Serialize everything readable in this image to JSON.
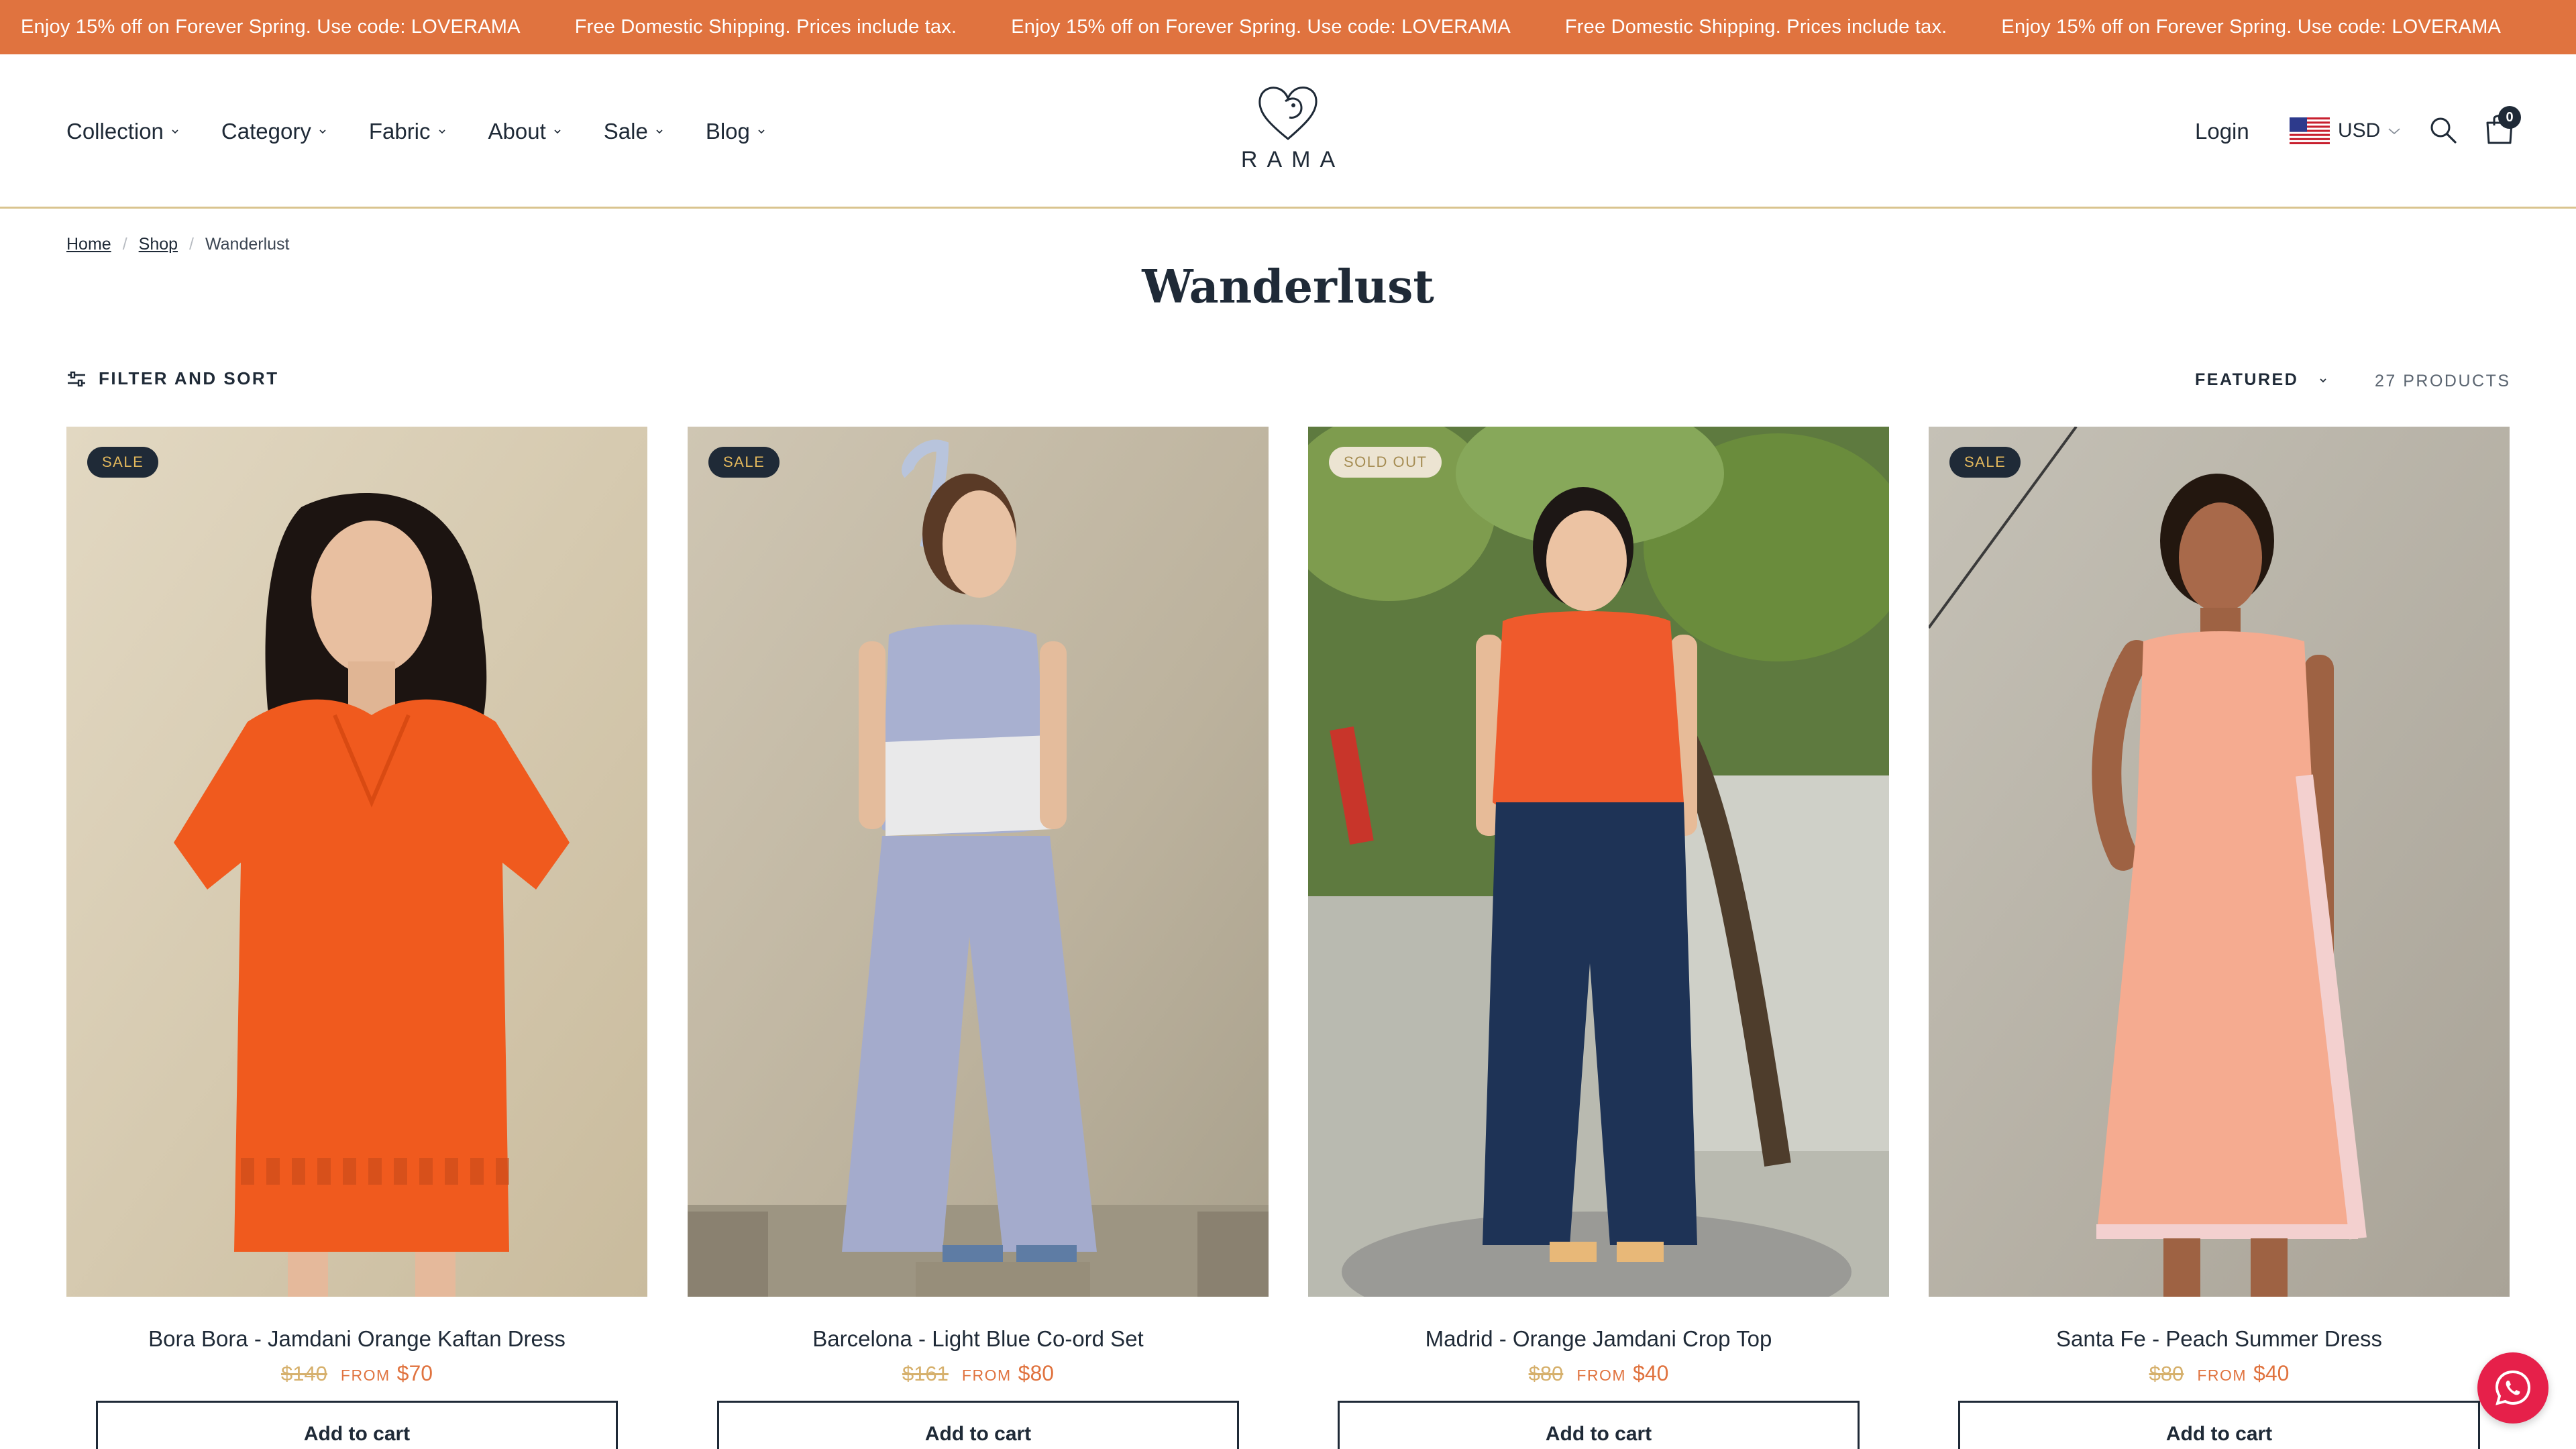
{
  "announcement": {
    "items": [
      "Enjoy 15% off on Forever Spring. Use code: LOVERAMA",
      "Free Domestic Shipping. Prices include tax.",
      "Enjoy 15% off on Forever Spring. Use code: LOVERAMA",
      "Free Domestic Shipping. Prices include tax.",
      "Enjoy 15% off on Forever Spring. Use code: LOVERAMA"
    ],
    "background": "#e0733f"
  },
  "header": {
    "nav": [
      "Collection",
      "Category",
      "Fabric",
      "About",
      "Sale",
      "Blog"
    ],
    "logo_text": "RAMA",
    "login_label": "Login",
    "currency": "USD",
    "cart_count": "0"
  },
  "breadcrumb": {
    "home": "Home",
    "shop": "Shop",
    "current": "Wanderlust"
  },
  "page_title": "Wanderlust",
  "toolbar": {
    "filter_label": "FILTER AND SORT",
    "sort_label": "FEATURED",
    "product_count": "27 PRODUCTS"
  },
  "products": [
    {
      "badge": "SALE",
      "title": "Bora Bora - Jamdani Orange Kaftan Dress",
      "old_price": "$140",
      "from_label": "FROM",
      "price": "$70",
      "button": "Add to cart",
      "garment_color": "#f05a1e",
      "bg_color": "#d9cdb4"
    },
    {
      "badge": "SALE",
      "title": "Barcelona - Light Blue Co-ord Set",
      "old_price": "$161",
      "from_label": "FROM",
      "price": "$80",
      "button": "Add to cart",
      "garment_color": "#a4abcc",
      "bg_color": "#c4bba8"
    },
    {
      "badge": "SOLD OUT",
      "title": "Madrid - Orange Jamdani Crop Top",
      "old_price": "$80",
      "from_label": "FROM",
      "price": "$40",
      "button": "Add to cart",
      "garment_color": "#ef5a2c",
      "bg_color": "#6f8a4b"
    },
    {
      "badge": "SALE",
      "title": "Santa Fe - Peach Summer Dress",
      "old_price": "$80",
      "from_label": "FROM",
      "price": "$40",
      "button": "Add to cart",
      "garment_color": "#f5ab90",
      "bg_color": "#b7b2a6"
    }
  ],
  "colors": {
    "accent": "#e0733f",
    "text": "#1f2a37",
    "badge_sale_bg": "#1f2a37",
    "badge_sale_text": "#e3b85c"
  }
}
